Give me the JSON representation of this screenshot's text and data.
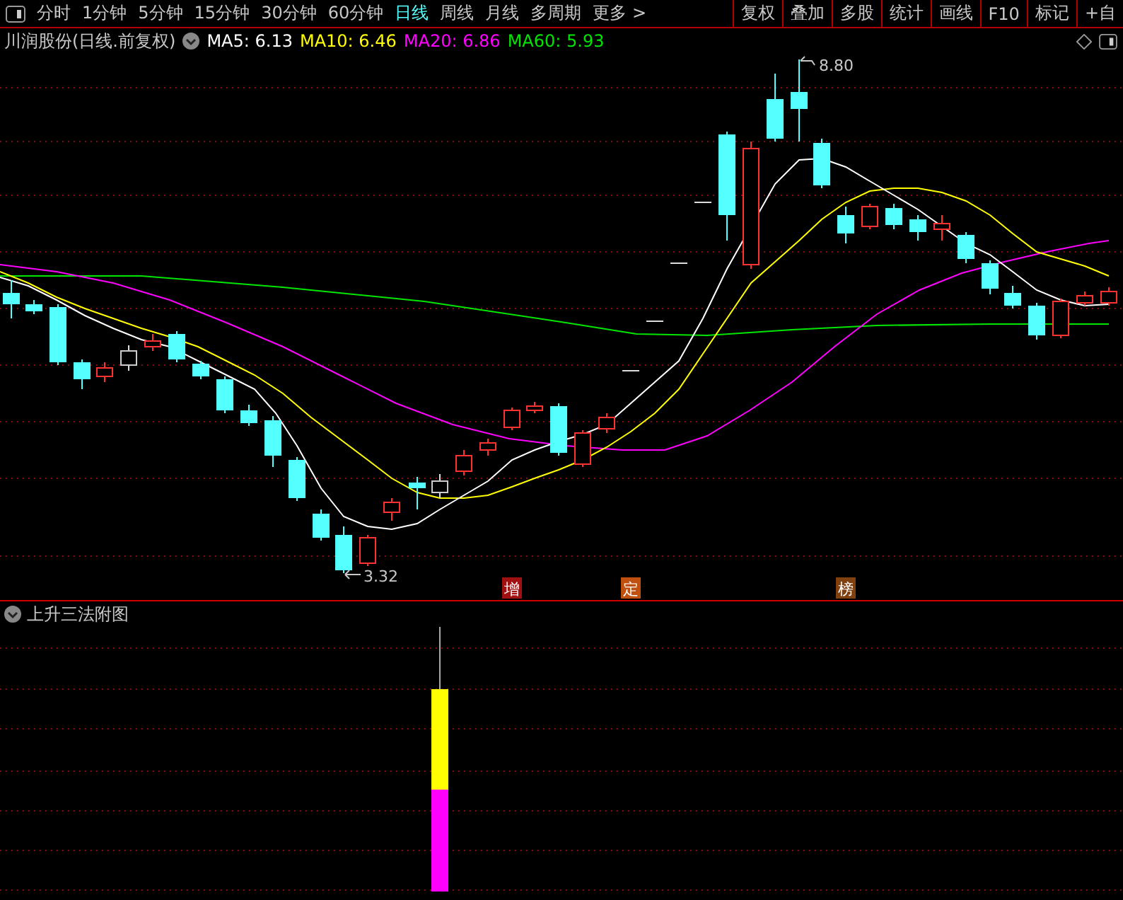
{
  "toolbar": {
    "periods": [
      {
        "label": "分时",
        "selected": false
      },
      {
        "label": "1分钟",
        "selected": false
      },
      {
        "label": "5分钟",
        "selected": false
      },
      {
        "label": "15分钟",
        "selected": false
      },
      {
        "label": "30分钟",
        "selected": false
      },
      {
        "label": "60分钟",
        "selected": false
      },
      {
        "label": "日线",
        "selected": true
      },
      {
        "label": "周线",
        "selected": false
      },
      {
        "label": "月线",
        "selected": false
      },
      {
        "label": "多周期",
        "selected": false
      }
    ],
    "more": "更多 >",
    "buttons": [
      "复权",
      "叠加",
      "多股",
      "统计",
      "画线",
      "F10",
      "标记",
      "+自"
    ]
  },
  "chart": {
    "title": "川润股份(日线.前复权)",
    "legend": [
      {
        "label": "MA5: 6.13",
        "color": "#ffffff"
      },
      {
        "label": "MA10: 6.46",
        "color": "#ffff00"
      },
      {
        "label": "MA20: 6.86",
        "color": "#ff00ff"
      },
      {
        "label": "MA60: 5.93",
        "color": "#00e600"
      }
    ],
    "high_label": "8.80",
    "low_label": "3.32",
    "markers": [
      {
        "label": "增",
        "color": "#a01010"
      },
      {
        "label": "定",
        "color": "#c05010"
      },
      {
        "label": "榜",
        "color": "#804010"
      }
    ]
  },
  "indicator": {
    "title": "上升三法附图"
  }
}
